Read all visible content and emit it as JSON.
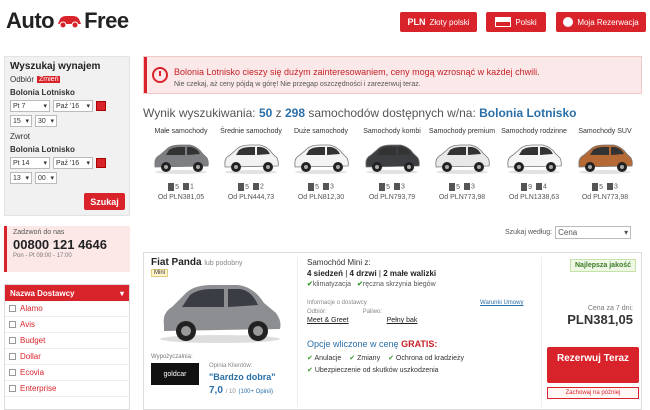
{
  "header": {
    "logo_left": "Auto",
    "logo_right": "Free",
    "currency_code": "PLN",
    "currency_label": "Złoty polski",
    "language": "Polski",
    "reservation": "Moja Rezerwacja"
  },
  "search": {
    "title": "Wyszukaj wynajem",
    "pickup_label": "Odbiór",
    "change": "Zmień",
    "pickup_location": "Bolonia Lotnisko",
    "pickup_day": "Pt 7",
    "pickup_month": "Paź '16",
    "pickup_hour": "15",
    "pickup_min": "30",
    "return_label": "Zwrot",
    "return_location": "Bolonia Lotnisko",
    "return_day": "Pt 14",
    "return_month": "Paź '16",
    "return_hour": "13",
    "return_min": "00",
    "button": "Szukaj"
  },
  "contact": {
    "title": "Zadzwoń do nas",
    "phone": "00800 121 4646",
    "hours": "Pon - Pt 09:00 - 17:00"
  },
  "suppliers": {
    "title": "Nazwa Dostawcy",
    "items": [
      "Alamo",
      "Avis",
      "Budget",
      "Dollar",
      "Ecovia",
      "Enterprise"
    ]
  },
  "alert": {
    "line1": "Bolonia Lotnisko cieszy się dużym zainteresowaniem, ceny mogą wzrosnąć w każdej chwili.",
    "line2": "Nie czekaj, aż ceny pójdą w górę! Nie przegap oszczędności i zarezerwuj teraz."
  },
  "results": {
    "prefix": "Wynik wyszukiwania:",
    "count": "50",
    "of": "z",
    "total": "298",
    "suffix": "samochodów dostępnych w/na:",
    "location": "Bolonia Lotnisko"
  },
  "categories": [
    {
      "label": "Małe samochody",
      "seats": "5",
      "bags": "1",
      "price": "Od PLN381,05",
      "color": "#7d7f82"
    },
    {
      "label": "Średnie samochody",
      "seats": "5",
      "bags": "2",
      "price": "Od PLN444,73",
      "color": "#f2f2f2"
    },
    {
      "label": "Duże samochody",
      "seats": "5",
      "bags": "3",
      "price": "Od PLN812,30",
      "color": "#f4f4f4"
    },
    {
      "label": "Samochody kombi",
      "seats": "5",
      "bags": "3",
      "price": "Od PLN793,79",
      "color": "#3d3f43"
    },
    {
      "label": "Samochody premium",
      "seats": "5",
      "bags": "3",
      "price": "Od PLN773,98",
      "color": "#e8e8e8"
    },
    {
      "label": "Samochody rodzinne",
      "seats": "9",
      "bags": "4",
      "price": "Od PLN1338,63",
      "color": "#f5f5f5"
    },
    {
      "label": "Samochody SUV",
      "seats": "5",
      "bags": "3",
      "price": "Od PLN773,98",
      "color": "#b56a36"
    }
  ],
  "sort": {
    "label": "Szukaj według:",
    "value": "Cena"
  },
  "offer": {
    "vehicle": "Fiat Panda",
    "similar": "lub podobny",
    "class_badge": "Mini",
    "supplier_label": "Wypożyczalnia:",
    "supplier_logo": "goldcar",
    "opinion_label": "Opinia Klientów:",
    "opinion_text": "\"Bardzo dobra\"",
    "score": "7,0",
    "score_max": "/ 10",
    "reviews": "(100+ Opinii)",
    "class_title": "Samochód Mini z:",
    "specs_seats": "4 siedzeń",
    "specs_doors": "4 drzwi",
    "specs_bags": "2 małe walizki",
    "feat1": "klimatyzacja",
    "feat2": "ręczna skrzynia biegów",
    "info_label": "Informacje o dostawcy",
    "terms": "Warunki Umowy",
    "pickup_label": "Odbiór:",
    "pickup_value": "Meet & Greet",
    "fuel_label": "Paliwo:",
    "fuel_value": "Pełny bak",
    "opt_prefix": "Opcje wliczone w cenę",
    "opt_free": "GRATIS:",
    "opt1": "Anulacje",
    "opt2": "Zmiany",
    "opt3": "Ochrona od kradzieży",
    "opt4": "Ubezpieczenie od skutków uszkodzenia",
    "badge": "Najlepsza jakość",
    "price_label": "Cena za 7 dni:",
    "price": "PLN381,05",
    "book": "Rezerwuj Teraz",
    "later": "Zachowaj na później"
  },
  "colors": {
    "brand": "#d9232b",
    "link": "#2a6fa8",
    "ok": "#3c9a31"
  }
}
